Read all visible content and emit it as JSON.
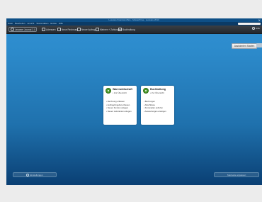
{
  "window": {
    "title": "Lexware financial office - Musterfirma - Lexware 2014"
  },
  "menubar": {
    "items": [
      "Datei",
      "Bearbeiten",
      "Ansicht",
      "Stammdaten",
      "Extras",
      "Hilfe"
    ],
    "search_placeholder": ""
  },
  "toolbar": {
    "items": [
      {
        "label": "Lexware Journal 2.0",
        "icon": "home-icon"
      },
      {
        "label": "Adressen",
        "icon": "contacts-icon"
      },
      {
        "label": "Neue Rechnung",
        "icon": "invoice-icon"
      },
      {
        "label": "Neuer Auftrag",
        "icon": "document-icon"
      },
      {
        "label": "Mahnen + Zahlungen",
        "icon": "payment-icon"
      },
      {
        "label": "Buchhaltung",
        "icon": "ledger-icon"
      }
    ],
    "right_label": "Hilfe"
  },
  "wizard_button": {
    "label": "Assistenten Starten"
  },
  "cards": [
    {
      "title": "Warenwirtschaft",
      "subtitle": "• Zur Übersicht",
      "items": [
        "Rechnung erfassen",
        "Auftrag/Angebot erfassen",
        "Neuen Kunden anlegen",
        "Neuen Lieferanten anlegen"
      ],
      "icon": "check-circle-icon"
    },
    {
      "title": "Buchhaltung",
      "subtitle": "• Zur Übersicht",
      "items": [
        "Buchungen",
        "Abschlüsse",
        "Kontenplan aufrufen",
        "Auswertungen anzeigen"
      ],
      "icon": "check-circle-icon"
    }
  ],
  "footer": {
    "left_label": "Einstellungen",
    "right_label": "Startseite anpassen"
  }
}
